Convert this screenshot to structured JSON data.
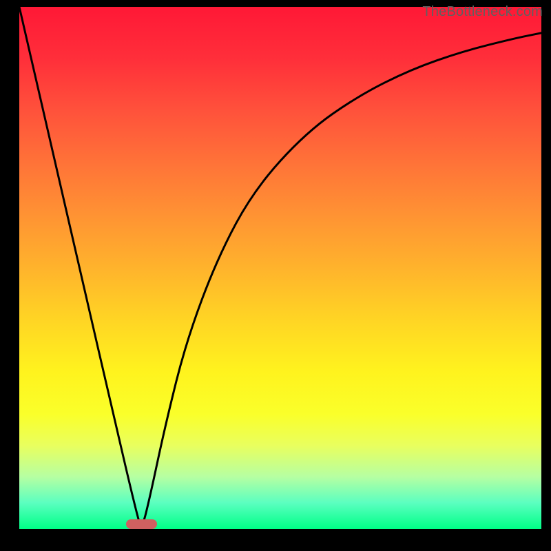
{
  "watermark": "TheBottleneck.com",
  "chart_data": {
    "type": "line",
    "title": "",
    "xlabel": "",
    "ylabel": "",
    "xlim": [
      0,
      100
    ],
    "ylim": [
      0,
      100
    ],
    "grid": false,
    "legend": false,
    "background_gradient": {
      "top": "#ff1836",
      "middle": "#ffe822",
      "bottom": "#00ff87"
    },
    "series": [
      {
        "name": "bottleneck-curve",
        "color": "#000000",
        "x": [
          0,
          6,
          12,
          18,
          22.7,
          23.5,
          25,
          28,
          32,
          38,
          45,
          55,
          65,
          75,
          85,
          95,
          100
        ],
        "values": [
          100,
          74,
          48,
          22,
          2,
          0,
          6,
          20,
          36,
          52,
          65,
          76,
          83,
          88,
          91.5,
          94,
          95
        ]
      }
    ],
    "marker": {
      "name": "optimal-marker",
      "color": "#d06060",
      "x_center": 23.4,
      "y": 0,
      "width_pct": 6
    }
  }
}
